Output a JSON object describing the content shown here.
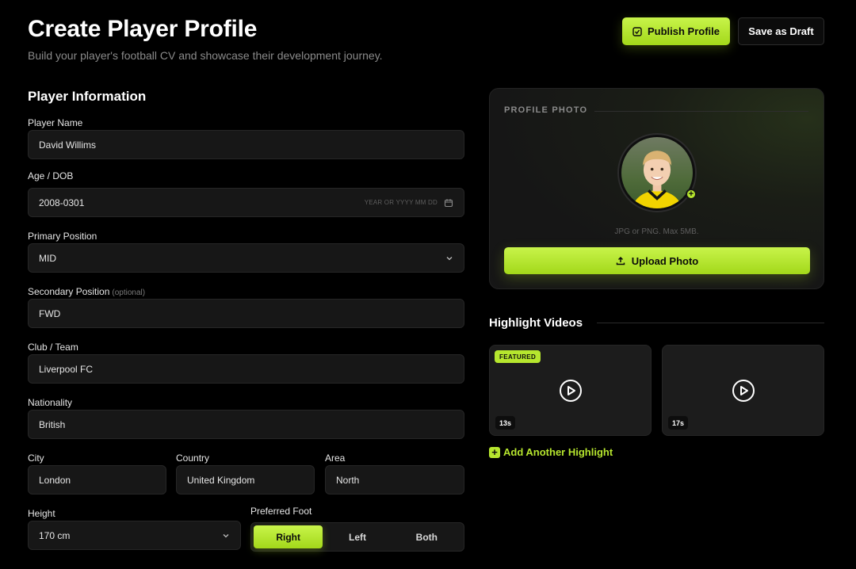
{
  "header": {
    "title": "Create Player Profile",
    "subtitle": "Build your player's football CV and showcase their development journey.",
    "publish_label": "Publish Profile",
    "draft_label": "Save as Draft"
  },
  "player_info": {
    "title": "Player Information",
    "name_label": "Player Name",
    "name_value": "David Willims",
    "dob_label": "Age / DOB",
    "dob_value": "2008-0301",
    "dob_hint": "YEAR OR YYYY MM DD",
    "primary_label": "Primary Position",
    "primary_value": "MID",
    "secondary_label": "Secondary Position",
    "secondary_optional": "(optional)",
    "secondary_value": "FWD",
    "club_label": "Club / Team",
    "club_value": "Liverpool FC",
    "nationality_label": "Nationality",
    "nationality_value": "British",
    "city_label": "City",
    "city_value": "London",
    "country_label": "Country",
    "country_value": "United Kingdom",
    "area_label": "Area",
    "area_value": "North",
    "height_label": "Height",
    "height_value": "170 cm",
    "foot_label": "Preferred Foot",
    "foot_options": [
      "Right",
      "Left",
      "Both"
    ],
    "foot_selected": "Right"
  },
  "profile_photo": {
    "label": "PROFILE PHOTO",
    "hint": "JPG or PNG. Max 5MB.",
    "upload_label": "Upload Photo"
  },
  "highlights": {
    "title": "Highlight Videos",
    "featured_badge": "FEATURED",
    "videos": [
      {
        "duration": "13s",
        "featured": true
      },
      {
        "duration": "17s",
        "featured": false
      }
    ],
    "add_label": "Add Another Highlight"
  },
  "colors": {
    "accent": "#b6e62e",
    "background": "#000000",
    "input_bg": "#171717"
  }
}
